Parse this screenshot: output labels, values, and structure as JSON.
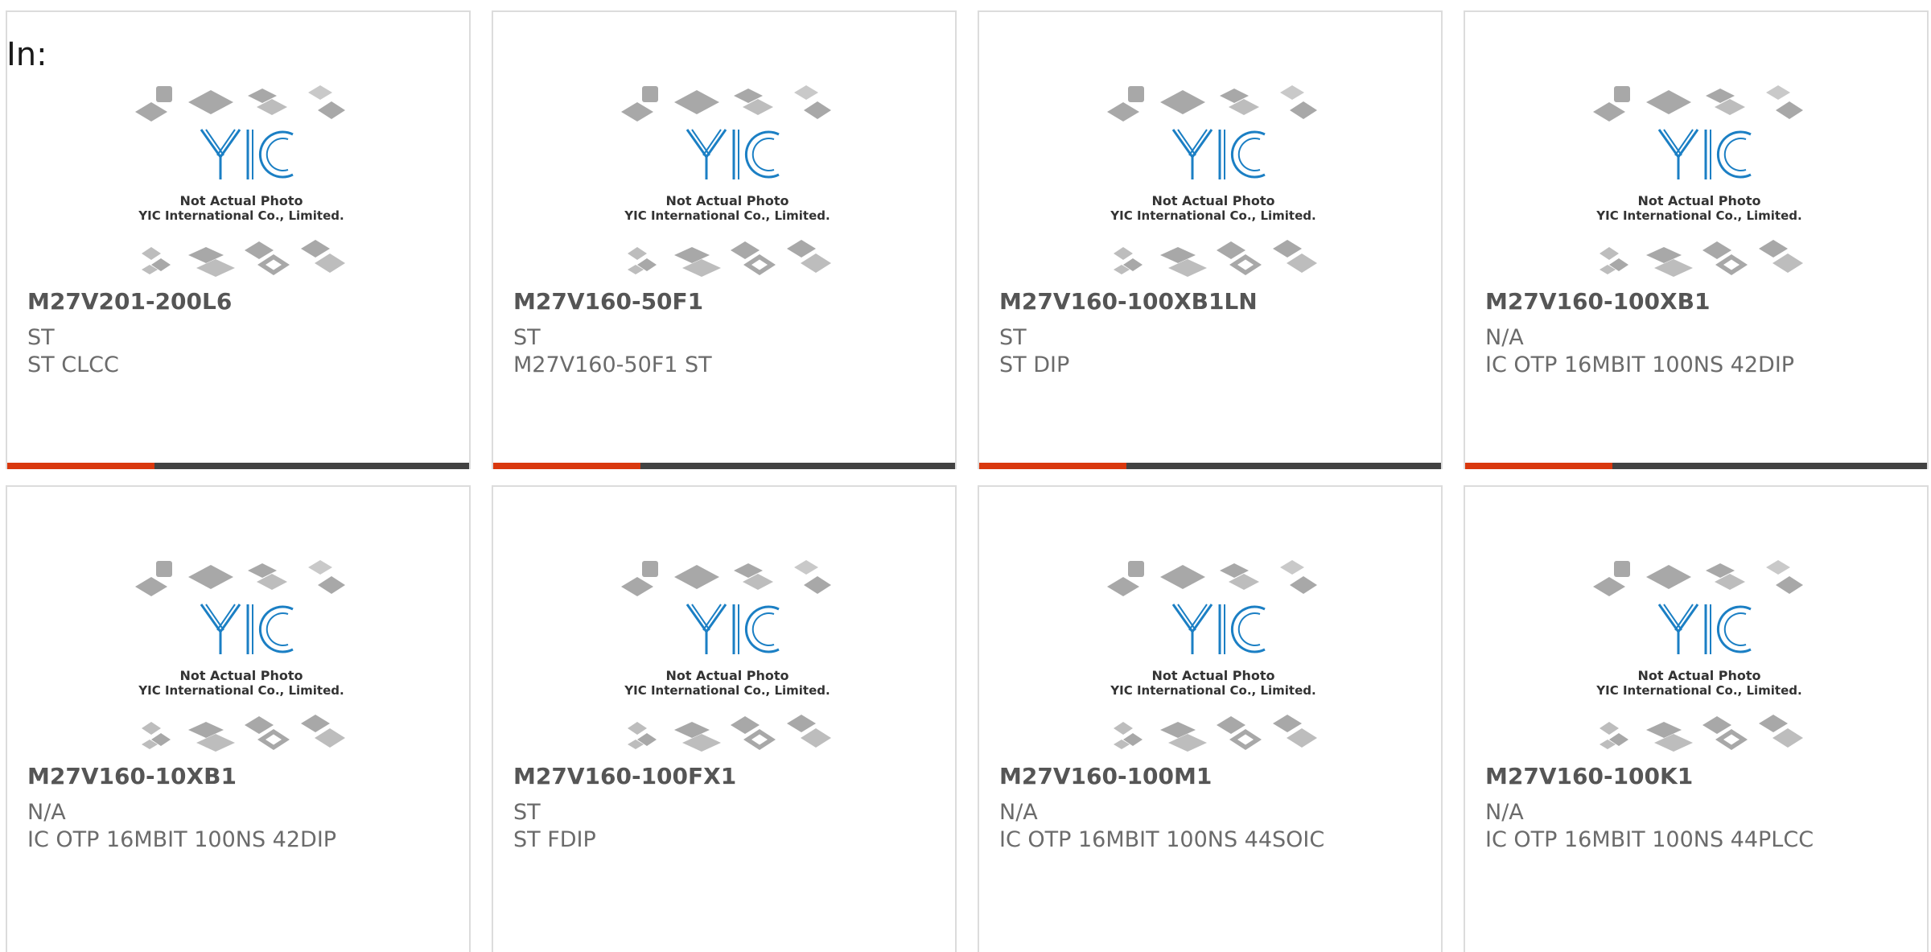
{
  "filter": {
    "label": "In:"
  },
  "theme": {
    "accent": "#d9380e",
    "bar_dark": "#424242",
    "chip": "#a8a8a8",
    "logo_blue": "#1b7fc4"
  },
  "image_placeholder": {
    "line1": "Not Actual Photo",
    "line2": "YIC International Co., Limited."
  },
  "products": [
    {
      "name": "M27V201-200L6",
      "maker": "ST",
      "desc": "ST CLCC"
    },
    {
      "name": "M27V160-50F1",
      "maker": "ST",
      "desc": "M27V160-50F1 ST"
    },
    {
      "name": "M27V160-100XB1LN",
      "maker": "ST",
      "desc": "ST DIP"
    },
    {
      "name": "M27V160-100XB1",
      "maker": "N/A",
      "desc": "IC OTP 16MBIT 100NS 42DIP"
    },
    {
      "name": "M27V160-10XB1",
      "maker": "N/A",
      "desc": "IC OTP 16MBIT 100NS 42DIP"
    },
    {
      "name": "M27V160-100FX1",
      "maker": "ST",
      "desc": "ST FDIP"
    },
    {
      "name": "M27V160-100M1",
      "maker": "N/A",
      "desc": "IC OTP 16MBIT 100NS 44SOIC"
    },
    {
      "name": "M27V160-100K1",
      "maker": "N/A",
      "desc": "IC OTP 16MBIT 100NS 44PLCC"
    }
  ]
}
